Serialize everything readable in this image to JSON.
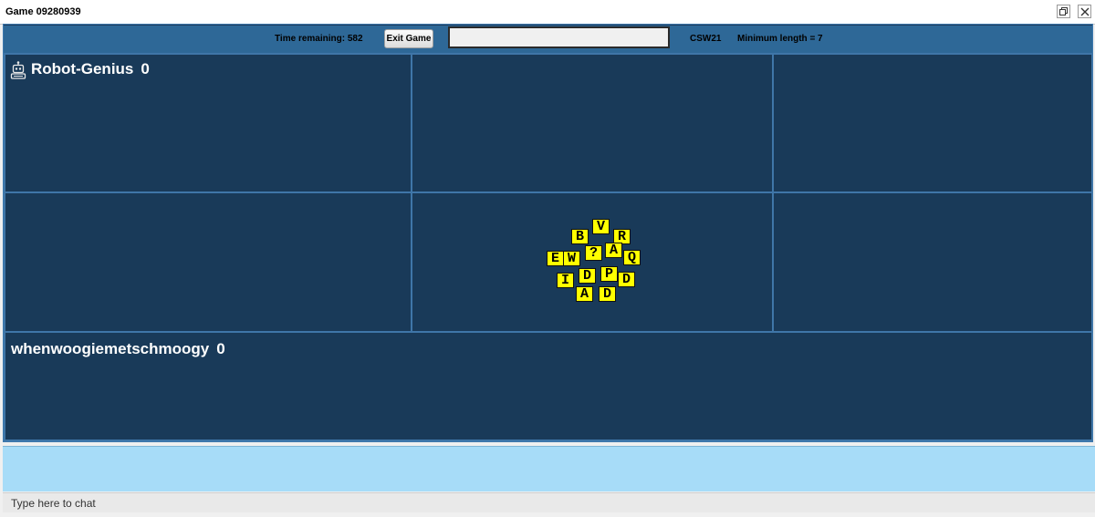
{
  "window": {
    "title": "Game 09280939"
  },
  "toolbar": {
    "time_label": "Time remaining: 582",
    "exit_label": "Exit Game",
    "word_input_value": "",
    "lexicon": "CSW21",
    "min_length_label": "Minimum length = 7"
  },
  "players": [
    {
      "name": "Robot-Genius",
      "score": "0",
      "icon": "robot-icon"
    },
    {
      "name": "whenwoogiemetschmoogy",
      "score": "0"
    }
  ],
  "tiles": [
    "B",
    "V",
    "R",
    "E",
    "W",
    "?",
    "A",
    "Q",
    "I",
    "D",
    "P",
    "D",
    "A",
    "D"
  ],
  "chat": {
    "placeholder": "Type here to chat"
  },
  "colors": {
    "board": "#193a59",
    "toolbar": "#2e6897",
    "tile": "#ffff00",
    "chat_log": "#a7dcf8"
  }
}
